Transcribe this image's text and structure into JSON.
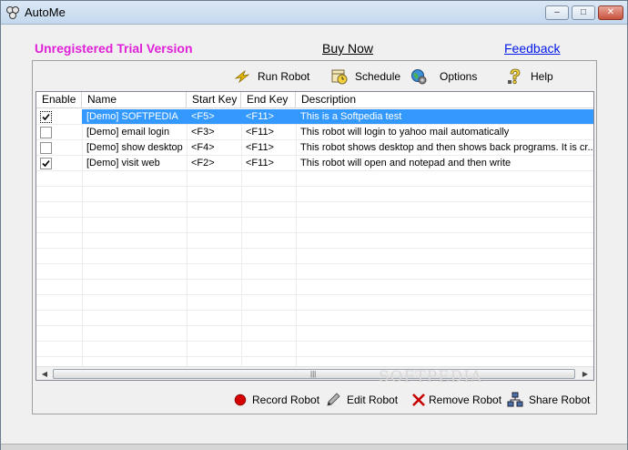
{
  "window": {
    "title": "AutoMe",
    "controls": {
      "minimize": "–",
      "maximize": "□",
      "close": "✕"
    }
  },
  "header": {
    "trial_label": "Unregistered Trial Version",
    "buy_now": "Buy Now",
    "feedback": "Feedback"
  },
  "toolbar": {
    "run_robot": "Run Robot",
    "schedule": "Schedule",
    "options": "Options",
    "help": "Help"
  },
  "table": {
    "columns": [
      "Enable",
      "Name",
      "Start Key",
      "End Key",
      "Description"
    ],
    "rows": [
      {
        "enabled": true,
        "name": "[Demo] SOFTPEDIA",
        "start_key": "<F5>",
        "end_key": "<F11>",
        "description": "This is a Softpedia test"
      },
      {
        "enabled": false,
        "name": "[Demo] email login",
        "start_key": "<F3>",
        "end_key": "<F11>",
        "description": "This robot will login to yahoo mail automatically"
      },
      {
        "enabled": false,
        "name": "[Demo] show desktop",
        "start_key": "<F4>",
        "end_key": "<F11>",
        "description": "This robot shows desktop and then shows back programs. It is cr..."
      },
      {
        "enabled": true,
        "name": "[Demo] visit web",
        "start_key": "<F2>",
        "end_key": "<F11>",
        "description": "This robot will open and notepad and then write"
      }
    ],
    "selected_row": 0
  },
  "bottom_toolbar": {
    "record_robot": "Record Robot",
    "edit_robot": "Edit Robot",
    "remove_robot": "Remove Robot",
    "share_robot": "Share Robot"
  },
  "watermark": "SOFTPEDIA",
  "colors": {
    "trial": "#e020d8",
    "feedback_link": "#0018e8",
    "selection": "#3399ff"
  },
  "icons": {
    "run_robot": "lightning-icon",
    "schedule": "calendar-clock-icon",
    "options": "globe-gear-icon",
    "help": "question-icon",
    "record_robot": "record-dot-icon",
    "edit_robot": "pencil-icon",
    "remove_robot": "red-x-icon",
    "share_robot": "network-icon"
  }
}
